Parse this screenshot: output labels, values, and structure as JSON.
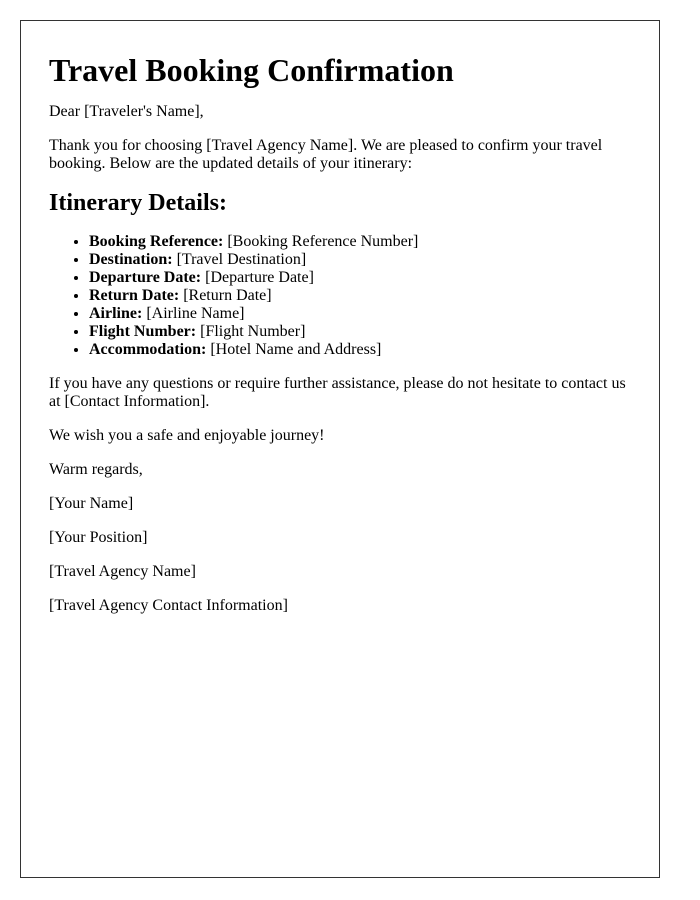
{
  "letter": {
    "title": "Travel Booking Confirmation",
    "greeting": "Dear [Traveler's Name],",
    "intro": "Thank you for choosing [Travel Agency Name]. We are pleased to confirm your travel booking. Below are the updated details of your itinerary:",
    "section_heading": "Itinerary Details:",
    "details": [
      {
        "label": "Booking Reference:",
        "value": "[Booking Reference Number]"
      },
      {
        "label": "Destination:",
        "value": "[Travel Destination]"
      },
      {
        "label": "Departure Date:",
        "value": "[Departure Date]"
      },
      {
        "label": "Return Date:",
        "value": "[Return Date]"
      },
      {
        "label": "Airline:",
        "value": "[Airline Name]"
      },
      {
        "label": "Flight Number:",
        "value": "[Flight Number]"
      },
      {
        "label": "Accommodation:",
        "value": "[Hotel Name and Address]"
      }
    ],
    "contact_paragraph": "If you have any questions or require further assistance, please do not hesitate to contact us at [Contact Information].",
    "wish": "We wish you a safe and enjoyable journey!",
    "closing": "Warm regards,",
    "signature": {
      "name": "[Your Name]",
      "position": "[Your Position]",
      "agency_name": "[Travel Agency Name]",
      "agency_contact": "[Travel Agency Contact Information]"
    }
  }
}
